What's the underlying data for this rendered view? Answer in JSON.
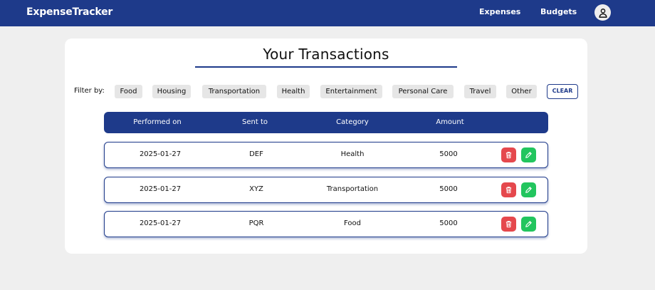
{
  "navbar": {
    "brand": "ExpenseTracker",
    "links": [
      "Expenses",
      "Budgets"
    ],
    "avatar_icon": "user-icon"
  },
  "main": {
    "title": "Your Transactions",
    "filter_label": "Filter by:",
    "filters": [
      "Food",
      "Housing",
      "Transportation",
      "Health",
      "Entertainment",
      "Personal Care",
      "Travel",
      "Other"
    ],
    "clear_label": "CLEAR",
    "columns": [
      "Performed on",
      "Sent to",
      "Category",
      "Amount"
    ],
    "rows": [
      {
        "date": "2025-01-27",
        "sent_to": "DEF",
        "category": "Health",
        "amount": "5000"
      },
      {
        "date": "2025-01-27",
        "sent_to": "XYZ",
        "category": "Transportation",
        "amount": "5000"
      },
      {
        "date": "2025-01-27",
        "sent_to": "PQR",
        "category": "Food",
        "amount": "5000"
      }
    ],
    "row_actions": {
      "delete_icon": "trash-icon",
      "edit_icon": "pencil-icon"
    }
  },
  "colors": {
    "primary": "#1e3a8a",
    "delete": "#e5484d",
    "edit": "#22c55e",
    "background": "#efefef",
    "chip": "#e6e6e6"
  }
}
